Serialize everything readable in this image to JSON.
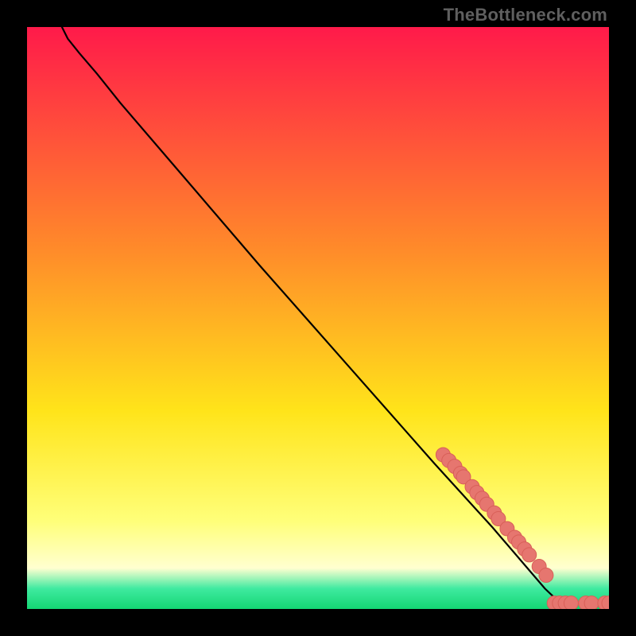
{
  "watermark": "TheBottleneck.com",
  "colors": {
    "gradient_top": "#ff1a4a",
    "gradient_mid_upper": "#ff8a2a",
    "gradient_mid": "#ffe41a",
    "gradient_lower": "#ffff7a",
    "gradient_pale": "#ffffd0",
    "gradient_teal": "#3feaa0",
    "gradient_green": "#14d673",
    "curve": "#000000",
    "marker_fill": "#e6766f",
    "marker_stroke": "#d85f58"
  },
  "chart_data": {
    "type": "line",
    "title": "",
    "xlabel": "",
    "ylabel": "",
    "xlim": [
      0,
      100
    ],
    "ylim": [
      0,
      100
    ],
    "curve_points": [
      {
        "x": 6,
        "y": 100
      },
      {
        "x": 7,
        "y": 98
      },
      {
        "x": 9,
        "y": 95.5
      },
      {
        "x": 12,
        "y": 92
      },
      {
        "x": 16,
        "y": 87
      },
      {
        "x": 25,
        "y": 76.5
      },
      {
        "x": 40,
        "y": 59
      },
      {
        "x": 55,
        "y": 42
      },
      {
        "x": 70,
        "y": 25
      },
      {
        "x": 80,
        "y": 14
      },
      {
        "x": 86,
        "y": 7
      },
      {
        "x": 89,
        "y": 3.5
      },
      {
        "x": 91,
        "y": 1.6
      },
      {
        "x": 93,
        "y": 0.9
      },
      {
        "x": 100,
        "y": 0.8
      }
    ],
    "series": [
      {
        "name": "markers",
        "points": [
          {
            "x": 71.5,
            "y": 26.5
          },
          {
            "x": 72.5,
            "y": 25.5
          },
          {
            "x": 73.5,
            "y": 24.5
          },
          {
            "x": 74.5,
            "y": 23.3
          },
          {
            "x": 75.0,
            "y": 22.7
          },
          {
            "x": 76.5,
            "y": 21.0
          },
          {
            "x": 77.3,
            "y": 20.0
          },
          {
            "x": 78.2,
            "y": 19.0
          },
          {
            "x": 79.0,
            "y": 18.0
          },
          {
            "x": 80.3,
            "y": 16.5
          },
          {
            "x": 81.0,
            "y": 15.5
          },
          {
            "x": 82.5,
            "y": 13.8
          },
          {
            "x": 83.8,
            "y": 12.3
          },
          {
            "x": 84.5,
            "y": 11.5
          },
          {
            "x": 85.5,
            "y": 10.3
          },
          {
            "x": 86.3,
            "y": 9.3
          },
          {
            "x": 88.0,
            "y": 7.3
          },
          {
            "x": 89.2,
            "y": 5.8
          },
          {
            "x": 90.6,
            "y": 1.0
          },
          {
            "x": 91.5,
            "y": 1.0
          },
          {
            "x": 92.5,
            "y": 1.0
          },
          {
            "x": 93.5,
            "y": 1.0
          },
          {
            "x": 96.0,
            "y": 1.0
          },
          {
            "x": 97.0,
            "y": 1.0
          },
          {
            "x": 99.3,
            "y": 1.0
          },
          {
            "x": 100.0,
            "y": 1.0
          }
        ]
      }
    ]
  }
}
